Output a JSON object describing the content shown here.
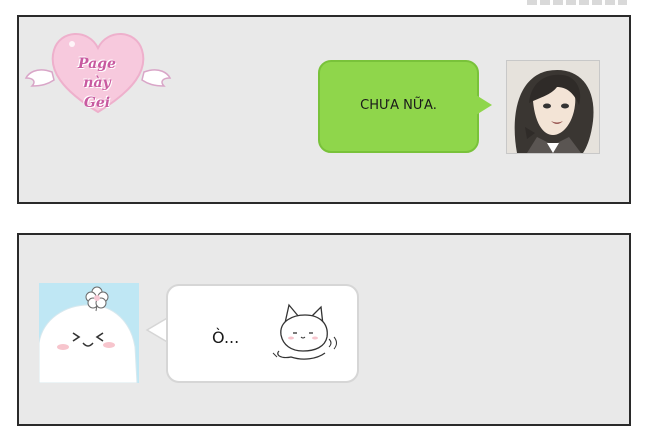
{
  "watermark": {
    "lines": [
      "Page",
      "này",
      "Gei"
    ]
  },
  "panel_1": {
    "message": "CHƯA NỮA."
  },
  "panel_2": {
    "message": "Ò..."
  },
  "colors": {
    "panel_bg": "#e9e9e9",
    "green_bubble": "#8fd64b",
    "white_bubble": "#ffffff",
    "avatar_blue_bg": "#bfe7f4",
    "logo_pink": "#c85aa0"
  }
}
